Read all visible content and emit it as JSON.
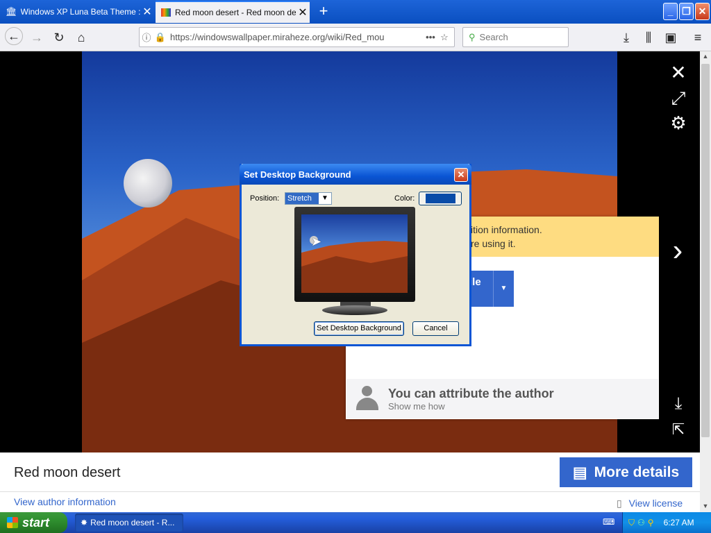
{
  "browser": {
    "tabs": [
      {
        "label": "Windows XP Luna Beta Theme : M",
        "active": false
      },
      {
        "label": "Red moon desert - Red moon dese",
        "active": true
      }
    ],
    "url": "https://windowswallpaper.miraheze.org/wiki/Red_mou",
    "search_placeholder": "Search"
  },
  "viewer": {
    "panel_notice_line1": "ition information.",
    "panel_notice_line2": "re using it.",
    "panel_button_label": "ile",
    "attribution_title": "You can attribute the author",
    "attribution_sub": "Show me how"
  },
  "dialog": {
    "title": "Set Desktop Background",
    "position_label": "Position:",
    "position_value": "Stretch",
    "color_label": "Color:",
    "color_value": "#0a4ca8",
    "ok_label": "Set Desktop Background",
    "cancel_label": "Cancel"
  },
  "page": {
    "image_title": "Red moon desert",
    "more_details": "More details",
    "author_link": "View author information",
    "license_link": "View license"
  },
  "taskbar": {
    "start_label": "start",
    "window_item": "Red moon desert - R...",
    "clock": "6:27 AM"
  },
  "colors": {
    "accent": "#3366cc",
    "notice": "#fedc81",
    "xp_blue": "#0a55d4"
  }
}
